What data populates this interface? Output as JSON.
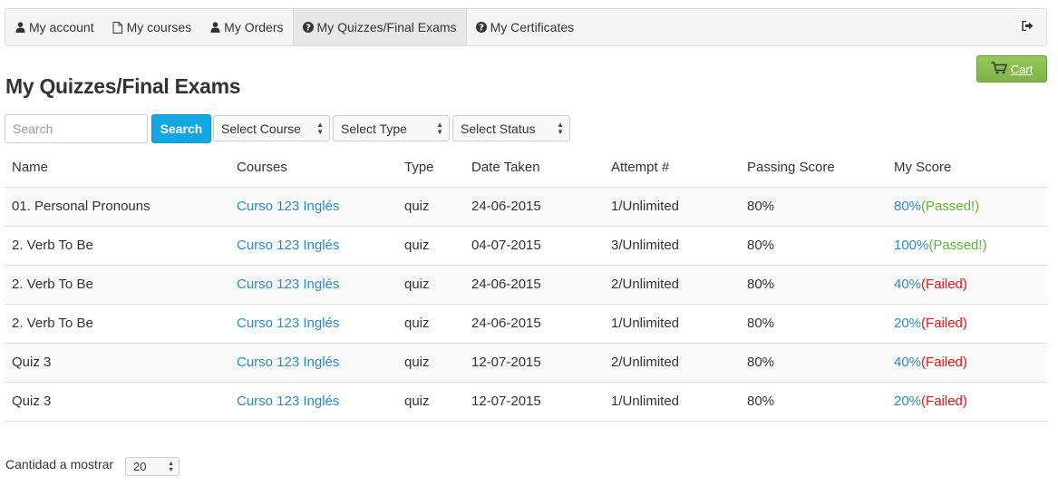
{
  "nav": {
    "items": [
      {
        "label": "My account",
        "icon": "user-icon"
      },
      {
        "label": "My courses",
        "icon": "file-icon"
      },
      {
        "label": "My Orders",
        "icon": "user-icon"
      },
      {
        "label": "My Quizzes/Final Exams",
        "icon": "question-circle-icon",
        "active": true
      },
      {
        "label": "My Certificates",
        "icon": "question-circle-icon"
      }
    ],
    "logout_icon": "sign-out-icon"
  },
  "cart": {
    "label": "Cart",
    "icon": "cart-icon",
    "color": "#8bc34a"
  },
  "page_title": "My Quizzes/Final Exams",
  "filters": {
    "search_placeholder": "Search",
    "search_button": "Search",
    "search_button_color": "#13a6e0",
    "course_select": "Select Course",
    "type_select": "Select Type",
    "status_select": "Select Status"
  },
  "table": {
    "headers": [
      "Name",
      "Courses",
      "Type",
      "Date Taken",
      "Attempt #",
      "Passing Score",
      "My Score"
    ],
    "rows": [
      {
        "name": "01. Personal Pronouns",
        "course": "Curso 123 Inglés",
        "type": "quiz",
        "date": "24-06-2015",
        "attempt": "1/Unlimited",
        "passing": "80%",
        "score": "80%",
        "result": "(Passed!)"
      },
      {
        "name": "2. Verb To Be",
        "course": "Curso 123 Inglés",
        "type": "quiz",
        "date": "04-07-2015",
        "attempt": "3/Unlimited",
        "passing": "80%",
        "score": "100%",
        "result": "(Passed!)"
      },
      {
        "name": "2. Verb To Be",
        "course": "Curso 123 Inglés",
        "type": "quiz",
        "date": "24-06-2015",
        "attempt": "2/Unlimited",
        "passing": "80%",
        "score": "40%",
        "result": "(Failed)"
      },
      {
        "name": "2. Verb To Be",
        "course": "Curso 123 Inglés",
        "type": "quiz",
        "date": "24-06-2015",
        "attempt": "1/Unlimited",
        "passing": "80%",
        "score": "20%",
        "result": "(Failed)"
      },
      {
        "name": "Quiz 3",
        "course": "Curso 123 Inglés",
        "type": "quiz",
        "date": "12-07-2015",
        "attempt": "2/Unlimited",
        "passing": "80%",
        "score": "40%",
        "result": "(Failed)"
      },
      {
        "name": "Quiz 3",
        "course": "Curso 123 Inglés",
        "type": "quiz",
        "date": "12-07-2015",
        "attempt": "1/Unlimited",
        "passing": "80%",
        "score": "20%",
        "result": "(Failed)"
      }
    ]
  },
  "footer": {
    "per_page_label": "Cantidad a mostrar",
    "per_page_value": "20"
  }
}
